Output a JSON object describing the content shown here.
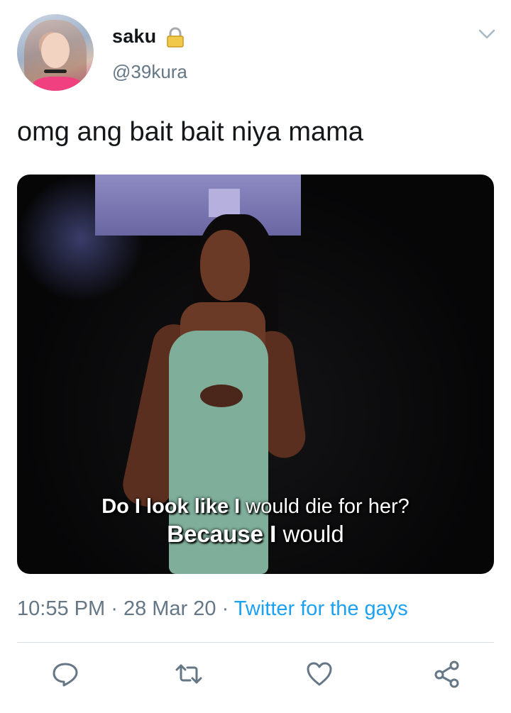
{
  "user": {
    "name": "saku",
    "handle": "@39kura"
  },
  "tweet": {
    "text": "omg ang bait bait niya mama"
  },
  "media": {
    "caption_line1_bold": "Do I look like I",
    "caption_line1_rest": " would die for her?",
    "caption_line2_bold": "Because I",
    "caption_line2_rest": " would"
  },
  "meta": {
    "time": "10:55 PM",
    "separator": "·",
    "date": "28 Mar 20",
    "source": "Twitter for the gays"
  },
  "icons": {
    "lock": "lock-icon",
    "more": "chevron-down-icon",
    "reply": "reply-icon",
    "retweet": "retweet-icon",
    "like": "heart-icon",
    "share": "share-icon"
  },
  "colors": {
    "link": "#1da1f2",
    "secondary": "#657786",
    "divider": "#d8e2e8"
  }
}
